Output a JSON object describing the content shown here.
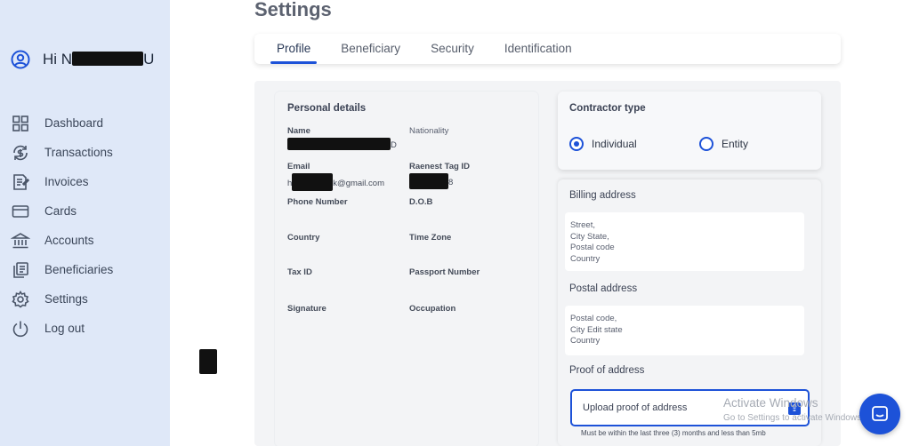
{
  "sidebar": {
    "greeting": "Hi N",
    "greeting_end": "U",
    "items": [
      {
        "label": "Dashboard",
        "icon": "grid-icon"
      },
      {
        "label": "Transactions",
        "icon": "dollar-cycle-icon"
      },
      {
        "label": "Invoices",
        "icon": "invoice-icon"
      },
      {
        "label": "Cards",
        "icon": "card-icon"
      },
      {
        "label": "Accounts",
        "icon": "bank-icon"
      },
      {
        "label": "Beneficiaries",
        "icon": "docs-icon"
      },
      {
        "label": "Settings",
        "icon": "gear-icon"
      },
      {
        "label": "Log out",
        "icon": "power-icon"
      }
    ]
  },
  "page": {
    "title": "Settings"
  },
  "tabs": [
    "Profile",
    "Beneficiary",
    "Security",
    "Identification"
  ],
  "personal": {
    "title": "Personal details",
    "name_label": "Name",
    "name_value_end": "D",
    "nationality_label": "Nationality",
    "email_label": "Email",
    "email_value_start": "h",
    "email_value_end": "k@gmail.com",
    "tag_label": "Raenest Tag ID",
    "tag_value_end": "8",
    "phone_label": "Phone Number",
    "dob_label": "D.O.B",
    "country_label": "Country",
    "timezone_label": "Time Zone",
    "taxid_label": "Tax ID",
    "passport_label": "Passport Number",
    "signature_label": "Signature",
    "occupation_label": "Occupation"
  },
  "contractor": {
    "title": "Contractor type",
    "options": [
      "Individual",
      "Entity"
    ],
    "selected": "Individual"
  },
  "billing": {
    "title": "Billing address",
    "lines": [
      "Street,",
      "City State,",
      "Postal code",
      "Country"
    ]
  },
  "postal": {
    "title": "Postal address",
    "lines": [
      "Postal code,",
      "City Edit state",
      "Country"
    ]
  },
  "proof": {
    "title": "Proof of address",
    "upload_label": "Upload proof of address",
    "hint": "Must be within the last three (3) months and less than 5mb"
  },
  "watermark": {
    "line1": "Activate Windows",
    "line2": "Go to Settings to activate Windows."
  },
  "colors": {
    "accent": "#1d52d8",
    "sidebar_bg": "#dfe8f8"
  }
}
